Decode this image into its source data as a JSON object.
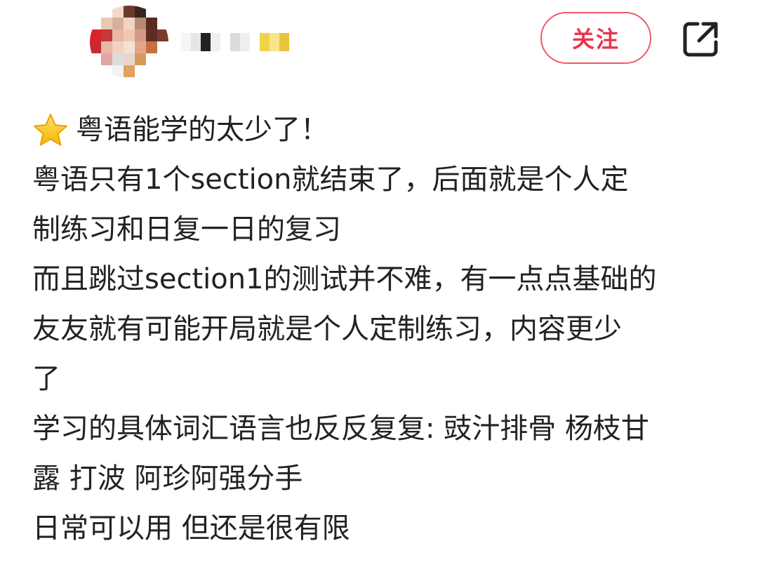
{
  "header": {
    "follow_label": "关注",
    "share_icon": "share-external-icon",
    "avatar_colors": [
      "#ffffff",
      "#ffffff",
      "#f4d9c9",
      "#6b3a2a",
      "#3a2420",
      "#ffffff",
      "#ffffff",
      "#ffffff",
      "#e9c8b4",
      "#d7b09a",
      "#f1d4c2",
      "#b88a72",
      "#5a2a20",
      "#ffffff",
      "#d8242c",
      "#c4393b",
      "#e7b9a4",
      "#f0c7b3",
      "#d59a86",
      "#5c2d26",
      "#7a3a2c",
      "#c92a30",
      "#e6b7a8",
      "#f3d1c0",
      "#f6e0d4",
      "#e2a58c",
      "#c7703e",
      "#ffffff",
      "#ffffff",
      "#e0a7a2",
      "#dcdcdc",
      "#e8d6cc",
      "#d89a5c",
      "#ffffff",
      "#ffffff",
      "#ffffff",
      "#ffffff",
      "#f2f2f2",
      "#e2a15e",
      "#ffffff",
      "#ffffff",
      "#ffffff"
    ],
    "username_colors": [
      "#f5f5f5",
      "#e6e6e6",
      "#222222",
      "#f0f0f0",
      "#ffffff",
      "#dcdcdc",
      "#eeeeee",
      "#ffffff",
      "#f0d34a",
      "#fbe58a",
      "#e9c33c",
      "#ffffff"
    ]
  },
  "post": {
    "title_icon": "star-icon",
    "title": "粤语能学的太少了！",
    "lines": [
      "粤语只有1个section就结束了，后面就是个人定",
      "制练习和日复一日的复习",
      "而且跳过section1的测试并不难，有一点点基础的",
      "友友就有可能开局就是个人定制练习，内容更少",
      "了",
      "学习的具体词汇语言也反反复复: 豉汁排骨 杨枝甘",
      "露 打波 阿珍阿强分手",
      "日常可以用 但还是很有限"
    ]
  },
  "colors": {
    "accent": "#e8354a",
    "text": "#222222",
    "background": "#ffffff"
  }
}
